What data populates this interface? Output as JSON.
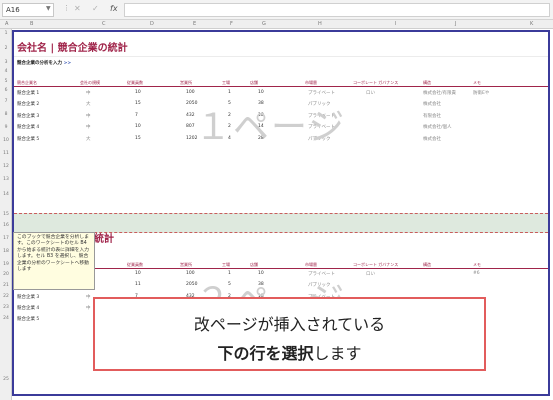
{
  "formula_bar": {
    "cell_ref": "A16",
    "cancel_glyph": "✕",
    "enter_glyph": "✓",
    "fx_label": "fx",
    "formula": ""
  },
  "columns": [
    "A",
    "B",
    "C",
    "D",
    "E",
    "F",
    "G",
    "H",
    "I",
    "J",
    "K"
  ],
  "rows": [
    "1",
    "2",
    "3",
    "4",
    "5",
    "6",
    "7",
    "8",
    "9",
    "10",
    "11",
    "12",
    "13",
    "14",
    "15",
    "16",
    "17",
    "18",
    "19",
    "20",
    "21",
    "22",
    "23",
    "24",
    "25"
  ],
  "sheet": {
    "title": "会社名 | 競合企業の統計",
    "subtitle": "競合企業の分析を入力",
    "subtitle_link": ">>",
    "headers": [
      "競合企業名",
      "会社の規模",
      "従業員数",
      "営業所",
      "工場",
      "店舗",
      "市場層",
      "コーポレート ガバナンス",
      "構造",
      "メモ"
    ],
    "rows_page1": [
      [
        "競合企業 1",
        "中",
        "10",
        "100",
        "1",
        "10",
        "プライベート",
        "ロい",
        "株式会社/有限責",
        "防衛Eや"
      ],
      [
        "競合企業 2",
        "大",
        "15",
        "2050",
        "5",
        "38",
        "パブリック",
        "",
        "株式会社",
        ""
      ],
      [
        "競合企業 3",
        "中",
        "7",
        "432",
        "2",
        "18",
        "プライベート",
        "",
        "有限会社",
        ""
      ],
      [
        "競合企業 4",
        "中",
        "10",
        "807",
        "2",
        "14",
        "プライベート",
        "",
        "株式会社/個人",
        ""
      ],
      [
        "競合企業 5",
        "大",
        "15",
        "1202",
        "4",
        "28",
        "パブリック",
        "",
        "株式会社",
        ""
      ]
    ],
    "title_page2_suffix": "の統計",
    "rows_page2": [
      [
        "競合企業 1",
        "",
        "10",
        "100",
        "1",
        "10",
        "プライベート",
        "ロい",
        "",
        "#6"
      ],
      [
        "",
        "",
        "11",
        "2050",
        "5",
        "38",
        "パブリック",
        "",
        "",
        ""
      ],
      [
        "競合企業 3",
        "中",
        "7",
        "432",
        "2",
        "18",
        "プライベート",
        "",
        "",
        ""
      ],
      [
        "競合企業 4",
        "中",
        "",
        "",
        "",
        "",
        "",
        "",
        "",
        ""
      ],
      [
        "競合企業 5",
        "",
        "",
        "",
        "",
        "",
        "",
        "",
        "",
        ""
      ]
    ],
    "watermark_page1": "１ページ",
    "watermark_page2": "２ページ"
  },
  "comment_text": "このブックで競合企業を分析します。このワークシートのセル B4 から始まる統計の表に詳細を入力します。セル B3 を選択し、競合企業の分析のワークシートへ移動します",
  "callout": {
    "line1": "改ページが挿入されている",
    "line2_bold": "下の行を選択",
    "line2_rest": "します"
  },
  "colors": {
    "accent": "#a0244a",
    "page_border": "#3b3b9a",
    "callout_border": "#e25c5c",
    "page_break_line": "#d04a4a"
  }
}
